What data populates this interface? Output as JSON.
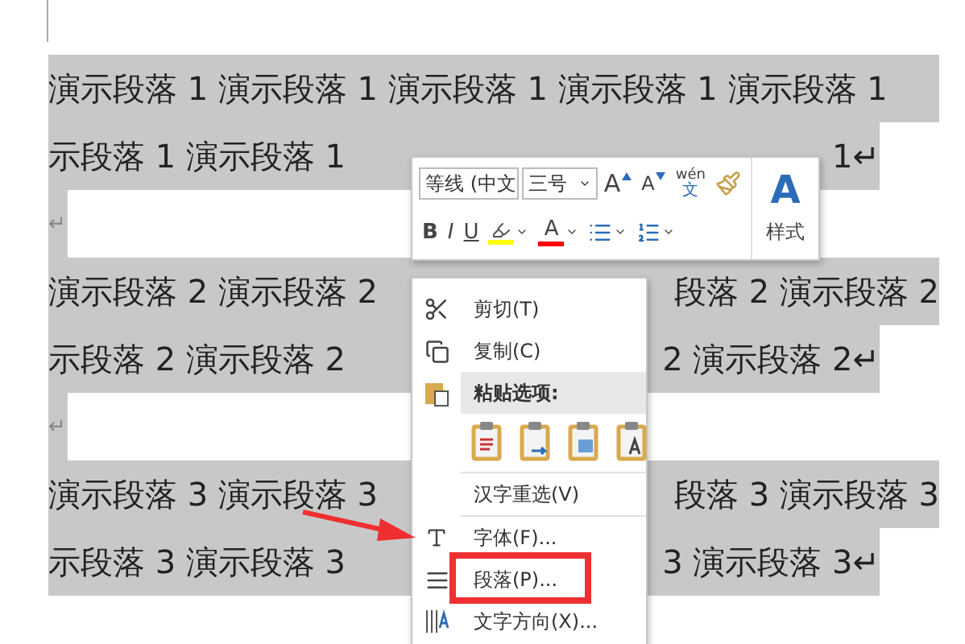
{
  "document": {
    "lines": [
      {
        "kind": "full",
        "left": "演示段落 1 演示段落 1 演示段落 1 演示段落 1 演示段落 1"
      },
      {
        "kind": "end",
        "left": "示段落 1 演示段落 1",
        "right": "1↵"
      },
      {
        "kind": "empty",
        "left": "↵"
      },
      {
        "kind": "full",
        "left": "演示段落 2 演示段落 2",
        "right": "段落 2 演示段落 2"
      },
      {
        "kind": "end",
        "left": "示段落 2 演示段落 2",
        "right": "2 演示段落 2↵"
      },
      {
        "kind": "empty",
        "left": "↵"
      },
      {
        "kind": "full",
        "left": "演示段落 3 演示段落 3",
        "right": "段落 3 演示段落 3"
      },
      {
        "kind": "end",
        "left": "示段落 3 演示段落 3",
        "right": "3 演示段落 3↵"
      }
    ]
  },
  "mini_toolbar": {
    "font_name": "等线 (中文",
    "font_size": "三号",
    "grow_font": "A",
    "shrink_font": "A",
    "phonetic_pinyin": "wén",
    "phonetic_char": "文",
    "bold": "B",
    "italic": "I",
    "underline": "U",
    "font_color_letter": "A",
    "styles_letter": "A",
    "styles_label": "样式"
  },
  "context_menu": {
    "items": [
      {
        "kind": "cut",
        "label": "剪切(T)"
      },
      {
        "kind": "copy",
        "label": "复制(C)"
      },
      {
        "kind": "header",
        "label": "粘贴选项:"
      },
      {
        "kind": "paste_options"
      },
      {
        "kind": "plain",
        "label": "汉字重选(V)"
      },
      {
        "kind": "font",
        "label": "字体(F)..."
      },
      {
        "kind": "paragraph",
        "label": "段落(P)..."
      },
      {
        "kind": "direction",
        "label": "文字方向(X)..."
      }
    ]
  }
}
